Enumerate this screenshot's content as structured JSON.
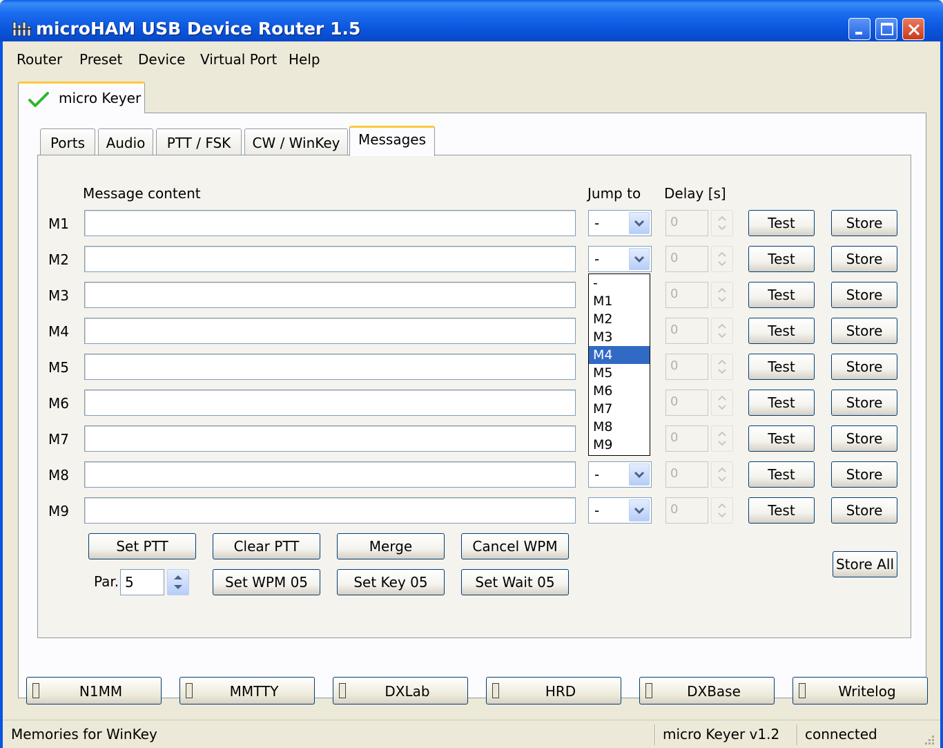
{
  "window": {
    "title": "microHAM USB Device Router 1.5"
  },
  "menu": [
    "Router",
    "Preset",
    "Device",
    "Virtual Port",
    "Help"
  ],
  "device_tab": {
    "label": "micro Keyer"
  },
  "tabs": [
    {
      "label": "Ports"
    },
    {
      "label": "Audio"
    },
    {
      "label": "PTT / FSK"
    },
    {
      "label": "CW / WinKey"
    },
    {
      "label": "Messages"
    }
  ],
  "headers": {
    "content": "Message content",
    "jump": "Jump to",
    "delay": "Delay [s]"
  },
  "messages": [
    {
      "label": "M1",
      "content": "",
      "jump": "-",
      "delay": "0"
    },
    {
      "label": "M2",
      "content": "",
      "jump": "-",
      "delay": "0"
    },
    {
      "label": "M3",
      "content": "",
      "jump": "",
      "delay": "0"
    },
    {
      "label": "M4",
      "content": "",
      "jump": "",
      "delay": "0"
    },
    {
      "label": "M5",
      "content": "",
      "jump": "",
      "delay": "0"
    },
    {
      "label": "M6",
      "content": "",
      "jump": "",
      "delay": "0"
    },
    {
      "label": "M7",
      "content": "",
      "jump": "",
      "delay": "0"
    },
    {
      "label": "M8",
      "content": "",
      "jump": "-",
      "delay": "0"
    },
    {
      "label": "M9",
      "content": "",
      "jump": "-",
      "delay": "0"
    }
  ],
  "row_buttons": {
    "test": "Test",
    "store": "Store"
  },
  "dropdown": {
    "options": [
      "-",
      "M1",
      "M2",
      "M3",
      "M4",
      "M5",
      "M6",
      "M7",
      "M8",
      "M9"
    ],
    "selected": "M4"
  },
  "commands": {
    "set_ptt": "Set PTT",
    "clear_ptt": "Clear PTT",
    "merge": "Merge",
    "cancel_wpm": "Cancel WPM",
    "set_wpm": "Set WPM 05",
    "set_key": "Set Key 05",
    "set_wait": "Set Wait 05",
    "store_all": "Store All"
  },
  "par": {
    "label": "Par.",
    "value": "5"
  },
  "apps": [
    "N1MM",
    "MMTTY",
    "DXLab",
    "HRD",
    "DXBase",
    "Writelog"
  ],
  "status": {
    "text": "Memories for WinKey",
    "device": "micro Keyer v1.2",
    "connection": "connected"
  },
  "colors": {
    "titlebar": "#0a54e2",
    "tab_highlight": "#ffc83c",
    "selection": "#316ac5",
    "check": "#2eb82e"
  }
}
